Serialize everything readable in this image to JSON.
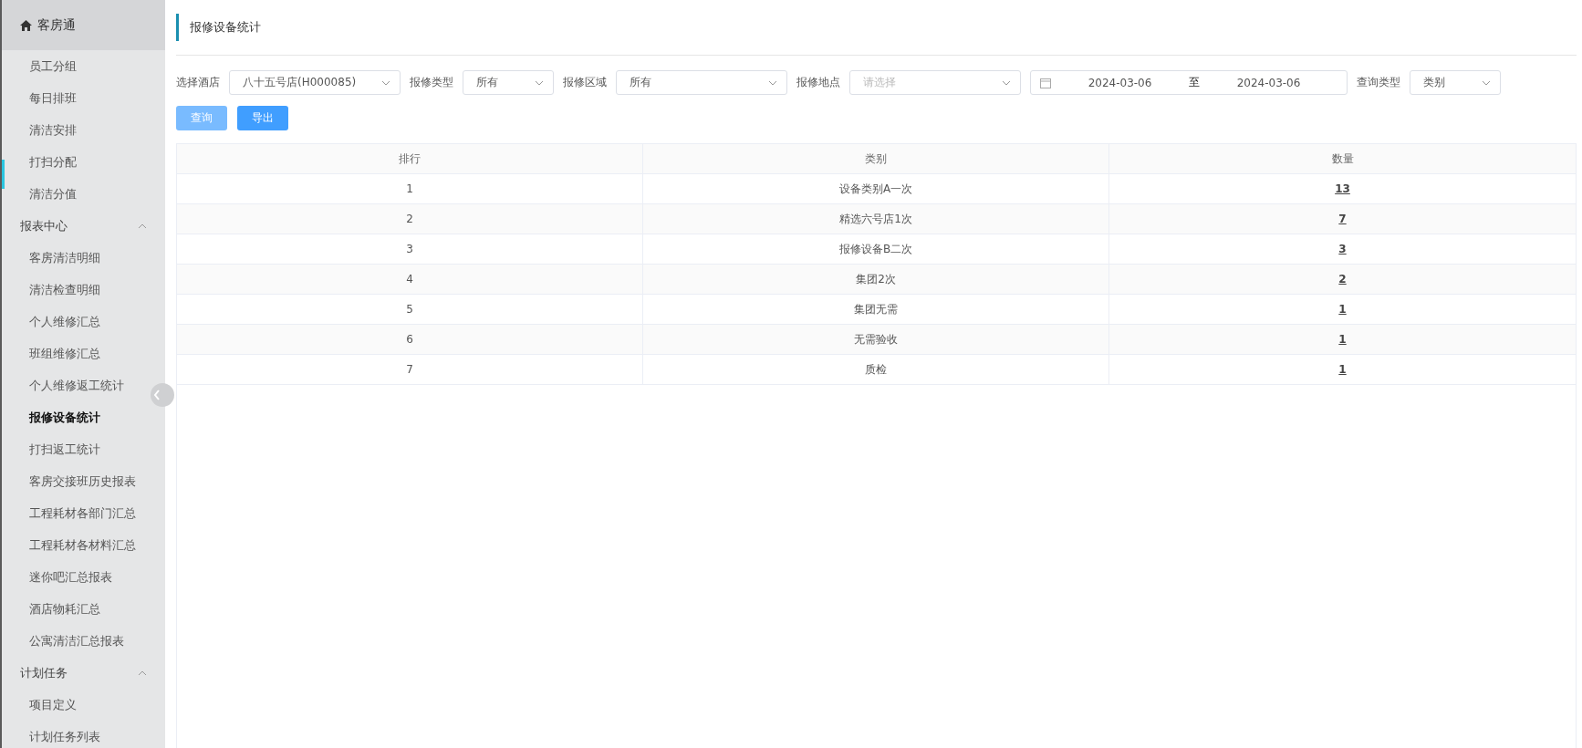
{
  "sidebar": {
    "brand": "客房通",
    "groups": [
      {
        "items": [
          {
            "label": "员工分组",
            "selected": false
          },
          {
            "label": "每日排班",
            "selected": false
          },
          {
            "label": "清洁安排",
            "selected": false
          },
          {
            "label": "打扫分配",
            "selected": false
          },
          {
            "label": "清洁分值",
            "selected": false
          }
        ]
      },
      {
        "title": "报表中心",
        "expanded": true,
        "items": [
          {
            "label": "客房清洁明细",
            "selected": false
          },
          {
            "label": "清洁检查明细",
            "selected": false
          },
          {
            "label": "个人维修汇总",
            "selected": false
          },
          {
            "label": "班组维修汇总",
            "selected": false
          },
          {
            "label": "个人维修返工统计",
            "selected": false
          },
          {
            "label": "报修设备统计",
            "selected": true
          },
          {
            "label": "打扫返工统计",
            "selected": false
          },
          {
            "label": "客房交接班历史报表",
            "selected": false
          },
          {
            "label": "工程耗材各部门汇总",
            "selected": false
          },
          {
            "label": "工程耗材各材料汇总",
            "selected": false
          },
          {
            "label": "迷你吧汇总报表",
            "selected": false
          },
          {
            "label": "酒店物耗汇总",
            "selected": false
          },
          {
            "label": "公寓清洁汇总报表",
            "selected": false
          }
        ]
      },
      {
        "title": "计划任务",
        "expanded": true,
        "items": [
          {
            "label": "项目定义",
            "selected": false
          },
          {
            "label": "计划任务列表",
            "selected": false
          }
        ]
      }
    ]
  },
  "page_title": "报修设备统计",
  "filters": [
    {
      "kind": "wide-select",
      "label": "选择酒店",
      "value": "八十五号店(H000085)"
    },
    {
      "kind": "select",
      "label": "报修类型",
      "value": "所有"
    },
    {
      "kind": "wide-select",
      "label": "报修区域",
      "value": "所有"
    },
    {
      "kind": "wide-select",
      "label": "报修地点",
      "placeholder": "请选择"
    },
    {
      "kind": "daterange",
      "start": "2024-03-06",
      "separator": "至",
      "end": "2024-03-06"
    },
    {
      "kind": "select",
      "label": "查询类型",
      "value": "类别"
    }
  ],
  "buttons": [
    {
      "label": "查询",
      "disabled": true
    },
    {
      "label": "导出",
      "disabled": false
    }
  ],
  "table": {
    "columns": [
      "排行",
      "类别",
      "数量"
    ],
    "rows": [
      {
        "rank": "1",
        "category": "设备类别A一次",
        "count": "13"
      },
      {
        "rank": "2",
        "category": "精选六号店1次",
        "count": "7"
      },
      {
        "rank": "3",
        "category": "报修设备B二次",
        "count": "3"
      },
      {
        "rank": "4",
        "category": "集团2次",
        "count": "2"
      },
      {
        "rank": "5",
        "category": "集团无需",
        "count": "1"
      },
      {
        "rank": "6",
        "category": "无需验收",
        "count": "1"
      },
      {
        "rank": "7",
        "category": "质检",
        "count": "1"
      }
    ]
  }
}
